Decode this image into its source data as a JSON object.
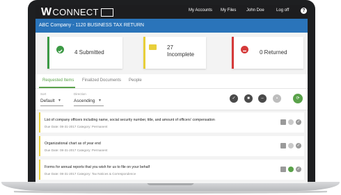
{
  "app": {
    "logo_prefix": "W",
    "logo_text": "CONNECT"
  },
  "nav": {
    "accounts": "My Accounts",
    "files": "My Files",
    "user": "John Doe",
    "logoff": "Log off",
    "help": "?"
  },
  "header": {
    "title": "ABC Company - 1120 BUSINESS TAX RETURN"
  },
  "cards": {
    "submitted": {
      "text": "4 Submitted",
      "color": "#3c9a45"
    },
    "incomplete": {
      "count": "27",
      "label": "Incomplete",
      "color": "#e8cf3a"
    },
    "returned": {
      "text": "0 Returned",
      "color": "#d53a3a"
    }
  },
  "tabs": [
    "Requested Items",
    "Finalized Documents",
    "People"
  ],
  "filters": {
    "sort_label": "Sort",
    "sort_value": "Default",
    "direction_label": "Direction",
    "direction_value": "Ascending"
  },
  "items": [
    {
      "title": "List of company officers including name, social security number, title, and amount of officers' compensation",
      "meta": "Due Date: 08-31-2017 Category: Permanent"
    },
    {
      "title": "Organizational chart as of year end",
      "meta": "Due Date: 08-31-2017 Category: Permanent"
    },
    {
      "title": "Forms for annual reports that you wish for us to file on your behalf",
      "meta": "Due Date: 08-31-2017 Category: Tax Notices & Correspondence"
    }
  ],
  "colors": {
    "accent": "#2a74ba",
    "green": "#5aa24a",
    "yellow": "#e8cf3a",
    "red": "#d53a3a"
  },
  "icons": [
    "check-circle-icon",
    "comment-icon",
    "minus-circle-icon",
    "chat-icon",
    "eye-icon",
    "refresh-icon"
  ]
}
